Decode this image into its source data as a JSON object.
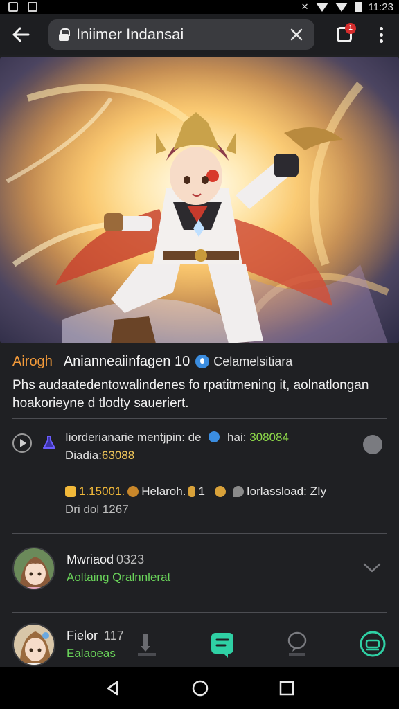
{
  "status_bar": {
    "time": "11:23"
  },
  "toolbar": {
    "url": "Iniimer Indansai",
    "tab_count": "1"
  },
  "video": {
    "tag": "Airogh",
    "title": "Anianneaiinfagen 10",
    "channel": "Celamelsitiara",
    "description": "Phs audaatedentowalindenes fo rpatitmening it, aolnatlongan hoakorieyne d tlodty saueriert.",
    "meta_line1_prefix": "Iiorderianarie mentjpin: de",
    "meta_line1_label": "hai:",
    "meta_line1_value": "308084",
    "meta_line2_prefix": "Diadia:",
    "meta_line2_value": "63088",
    "stats": {
      "likes": "1.15001.",
      "creator": "Helaroh.",
      "creator_count": "1",
      "location": "Iorlassload: ZIy"
    },
    "meta_line4": "Dri dol 1267"
  },
  "comments": [
    {
      "name": "Mwriaod",
      "number": "0323",
      "subtitle": "Aoltaing Qralnnlerat"
    },
    {
      "name": "Fielor",
      "number": "117",
      "subtitle": "Ealaoeas"
    }
  ],
  "colors": {
    "accent_green": "#2fd0a4",
    "tag_orange": "#f29a3a",
    "link_green": "#6ad45a",
    "background": "#1f2023"
  }
}
